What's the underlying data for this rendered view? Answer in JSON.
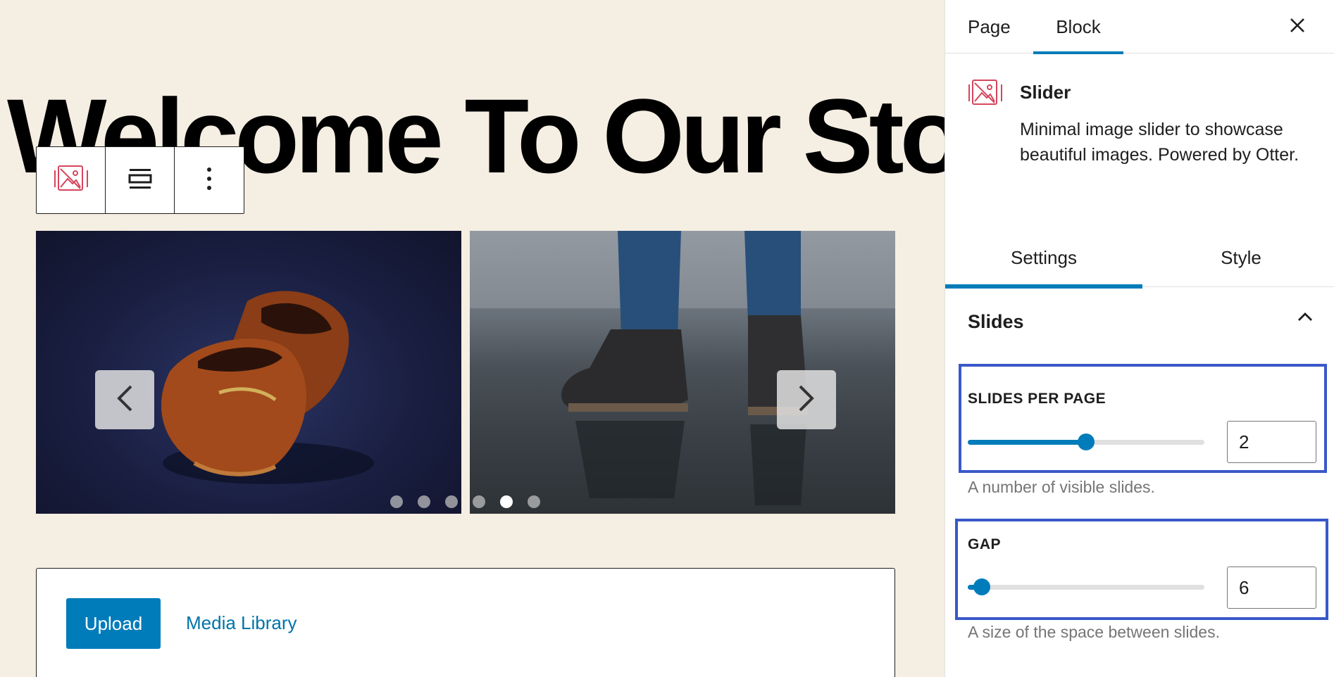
{
  "page": {
    "title": "Welcome To Our Store"
  },
  "slider": {
    "prev_icon": "chevron-left-icon",
    "next_icon": "chevron-right-icon",
    "dots_total": 6,
    "dots_active_index": 4
  },
  "gallery": {
    "upload_label": "Upload",
    "media_library_label": "Media Library"
  },
  "sidebar": {
    "tabs": [
      {
        "label": "Page"
      },
      {
        "label": "Block"
      }
    ],
    "active_tab": "Block",
    "close_icon": "close-icon",
    "block": {
      "name": "Slider",
      "description": "Minimal image slider to showcase beautiful images. Powered by Otter.",
      "icon": "slider-block-icon"
    },
    "inner_tabs": [
      {
        "label": "Settings"
      },
      {
        "label": "Style"
      }
    ],
    "active_inner_tab": "Settings",
    "panel": {
      "title": "Slides",
      "expanded": true
    },
    "slides_per_page": {
      "label": "SLIDES PER PAGE",
      "value": "2",
      "slider_fraction": 0.5,
      "help": "A number of visible slides."
    },
    "gap": {
      "label": "GAP",
      "value": "6",
      "slider_fraction": 0.06,
      "help": "A size of the space between slides."
    }
  },
  "colors": {
    "accent": "#007cba",
    "canvas_bg": "#f5eee2",
    "highlight_border": "#3958c9",
    "block_icon": "#d6455d"
  }
}
